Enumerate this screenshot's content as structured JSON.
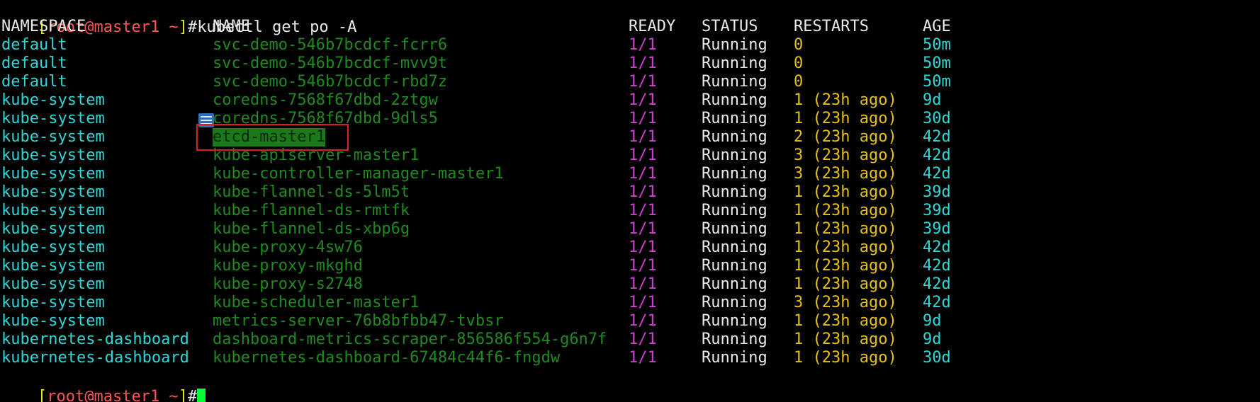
{
  "prompt_top": {
    "bracket_open": "[",
    "user": "root",
    "at": "@",
    "host": "master1",
    "path": " ~",
    "bracket_close": "]",
    "hash": "#",
    "command": "kubectl get po -A"
  },
  "headers": {
    "namespace": "NAMESPACE",
    "name": "NAME",
    "ready": "READY",
    "status": "STATUS",
    "restarts": "RESTARTS",
    "age": "AGE"
  },
  "rows": [
    {
      "namespace": "default",
      "name": "svc-demo-546b7bcdcf-fcrr6",
      "ready": "1/1",
      "status": "Running",
      "restarts": "0",
      "age": "50m"
    },
    {
      "namespace": "default",
      "name": "svc-demo-546b7bcdcf-mvv9t",
      "ready": "1/1",
      "status": "Running",
      "restarts": "0",
      "age": "50m"
    },
    {
      "namespace": "default",
      "name": "svc-demo-546b7bcdcf-rbd7z",
      "ready": "1/1",
      "status": "Running",
      "restarts": "0",
      "age": "50m"
    },
    {
      "namespace": "kube-system",
      "name": "coredns-7568f67dbd-2ztgw",
      "ready": "1/1",
      "status": "Running",
      "restarts": "1 (23h ago)",
      "age": "9d"
    },
    {
      "namespace": "kube-system",
      "name": "coredns-7568f67dbd-9dls5",
      "ready": "1/1",
      "status": "Running",
      "restarts": "1 (23h ago)",
      "age": "30d"
    },
    {
      "namespace": "kube-system",
      "name": "etcd-master1",
      "ready": "1/1",
      "status": "Running",
      "restarts": "2 (23h ago)",
      "age": "42d"
    },
    {
      "namespace": "kube-system",
      "name": "kube-apiserver-master1",
      "ready": "1/1",
      "status": "Running",
      "restarts": "3 (23h ago)",
      "age": "42d"
    },
    {
      "namespace": "kube-system",
      "name": "kube-controller-manager-master1",
      "ready": "1/1",
      "status": "Running",
      "restarts": "3 (23h ago)",
      "age": "42d"
    },
    {
      "namespace": "kube-system",
      "name": "kube-flannel-ds-5lm5t",
      "ready": "1/1",
      "status": "Running",
      "restarts": "1 (23h ago)",
      "age": "39d"
    },
    {
      "namespace": "kube-system",
      "name": "kube-flannel-ds-rmtfk",
      "ready": "1/1",
      "status": "Running",
      "restarts": "1 (23h ago)",
      "age": "39d"
    },
    {
      "namespace": "kube-system",
      "name": "kube-flannel-ds-xbp6g",
      "ready": "1/1",
      "status": "Running",
      "restarts": "1 (23h ago)",
      "age": "39d"
    },
    {
      "namespace": "kube-system",
      "name": "kube-proxy-4sw76",
      "ready": "1/1",
      "status": "Running",
      "restarts": "1 (23h ago)",
      "age": "42d"
    },
    {
      "namespace": "kube-system",
      "name": "kube-proxy-mkghd",
      "ready": "1/1",
      "status": "Running",
      "restarts": "1 (23h ago)",
      "age": "42d"
    },
    {
      "namespace": "kube-system",
      "name": "kube-proxy-s2748",
      "ready": "1/1",
      "status": "Running",
      "restarts": "1 (23h ago)",
      "age": "42d"
    },
    {
      "namespace": "kube-system",
      "name": "kube-scheduler-master1",
      "ready": "1/1",
      "status": "Running",
      "restarts": "3 (23h ago)",
      "age": "42d"
    },
    {
      "namespace": "kube-system",
      "name": "metrics-server-76b8bfbb47-tvbsr",
      "ready": "1/1",
      "status": "Running",
      "restarts": "1 (23h ago)",
      "age": "9d"
    },
    {
      "namespace": "kubernetes-dashboard",
      "name": "dashboard-metrics-scraper-856586f554-g6n7f",
      "ready": "1/1",
      "status": "Running",
      "restarts": "1 (23h ago)",
      "age": "9d"
    },
    {
      "namespace": "kubernetes-dashboard",
      "name": "kubernetes-dashboard-67484c44f6-fngdw",
      "ready": "1/1",
      "status": "Running",
      "restarts": "1 (23h ago)",
      "age": "30d"
    }
  ],
  "prompt_bottom": {
    "bracket_open": "[",
    "user": "root",
    "at": "@",
    "host": "master1",
    "path": " ~",
    "bracket_close": "]",
    "hash": "#"
  },
  "highlighted_row_index": 5,
  "annotations": {
    "note_icon": "note-icon",
    "highlight_box_color": "#d92020"
  },
  "colors": {
    "background": "#000000",
    "namespace": "#2ed6d6",
    "pod_name": "#1f8a1f",
    "ready": "#d040d0",
    "status": "#eaeaea",
    "restarts": "#e6c20e",
    "age": "#2ed6d6",
    "prompt_user": "#ff5555",
    "prompt_bracket": "#e6e600",
    "cursor": "#00ff33"
  }
}
